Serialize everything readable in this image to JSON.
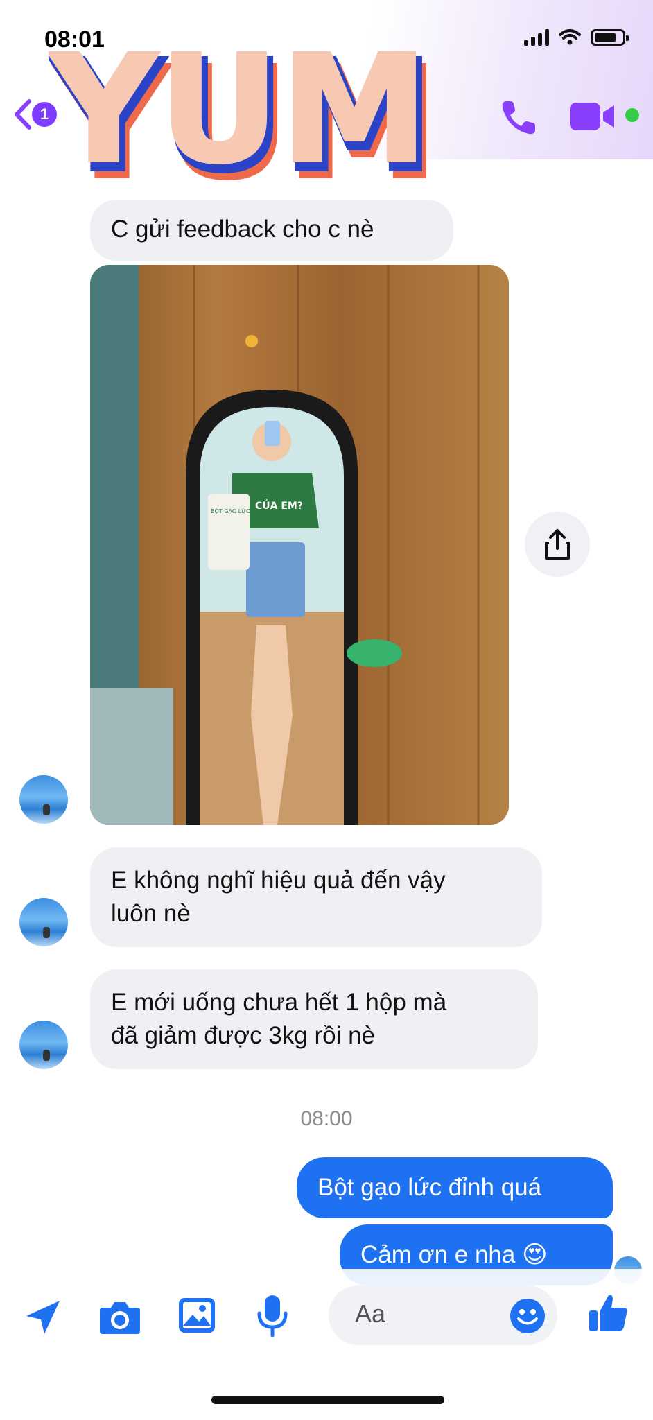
{
  "status_bar": {
    "time": "08:01"
  },
  "header": {
    "unread_count": "1",
    "logo_text": "YUM",
    "icons": {
      "back": "chevron-left-icon",
      "call": "phone-icon",
      "video": "video-camera-icon"
    }
  },
  "messages": [
    {
      "direction": "incoming",
      "text": "C gửi feedback cho c nè"
    },
    {
      "direction": "incoming",
      "type": "photo"
    },
    {
      "direction": "incoming",
      "lines": [
        "E không nghĩ hiệu quả đến vậy",
        "luôn nè"
      ]
    },
    {
      "direction": "incoming",
      "lines": [
        "E mới uống chưa hết 1 hộp mà",
        "đã giảm được 3kg rồi nè"
      ]
    }
  ],
  "timestamp": "08:00",
  "outgoing": [
    {
      "text": "Bột gạo lức đỉnh quá"
    },
    {
      "text": "Cảm ơn e nha 😍"
    }
  ],
  "photo_labels": {
    "shirt_text": "CỦA EM?",
    "bag_text": "BỘT GẠO LỨC YUM"
  },
  "composer": {
    "placeholder": "Aa",
    "icons": [
      "location-arrow-icon",
      "camera-icon",
      "image-icon",
      "microphone-icon",
      "emoji-icon",
      "thumbs-up-icon"
    ]
  },
  "colors": {
    "accent": "#1e72f2",
    "purple": "#8a3ffc",
    "bubble_in": "#eef0f3",
    "online": "#33cc44"
  }
}
